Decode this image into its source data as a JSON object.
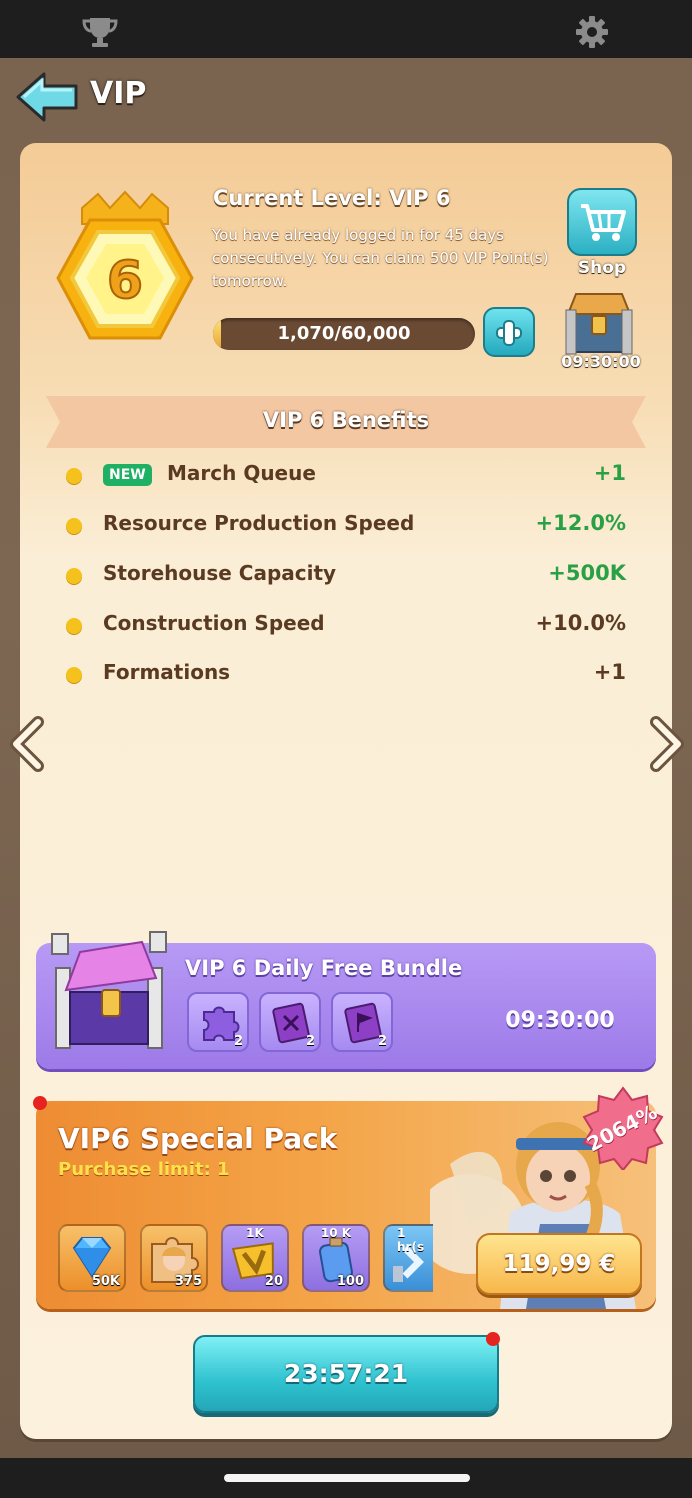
{
  "header": {
    "title": "VIP"
  },
  "vip": {
    "current_level": "Current Level: VIP 6",
    "level_number": "6",
    "login_message": "You have already logged in for 45 days consecutively. You can claim 500 VIP Point(s) tomorrow.",
    "progress_text": "1,070/60,000",
    "progress_fraction": 0.018,
    "shop_label": "Shop",
    "chest_timer": "09:30:00"
  },
  "benefits": {
    "title": "VIP 6 Benefits",
    "new_label": "NEW",
    "items": [
      {
        "name": "March Queue",
        "value": "+1",
        "is_new": true,
        "value_color": "green"
      },
      {
        "name": "Resource Production Speed",
        "value": "+12.0%",
        "is_new": false,
        "value_color": "green"
      },
      {
        "name": "Storehouse Capacity",
        "value": "+500K",
        "is_new": false,
        "value_color": "green"
      },
      {
        "name": "Construction Speed",
        "value": "+10.0%",
        "is_new": false,
        "value_color": "dark"
      },
      {
        "name": "Formations",
        "value": "+1",
        "is_new": false,
        "value_color": "dark"
      }
    ]
  },
  "daily_bundle": {
    "title": "VIP 6 Daily Free Bundle",
    "timer": "09:30:00",
    "items": [
      {
        "icon": "puzzle-piece-icon",
        "count": "2"
      },
      {
        "icon": "skill-book-icon",
        "count": "2"
      },
      {
        "icon": "flag-book-icon",
        "count": "2"
      }
    ]
  },
  "special_pack": {
    "title": "VIP6 Special Pack",
    "purchase_limit": "Purchase limit: 1",
    "discount": "2064%",
    "price": "119,99 €",
    "items": [
      {
        "icon": "diamond-icon",
        "top": "",
        "count": "50K"
      },
      {
        "icon": "hero-shard-icon",
        "top": "",
        "count": "375"
      },
      {
        "icon": "vip-point-icon",
        "top": "1K",
        "count": "20"
      },
      {
        "icon": "exp-potion-icon",
        "top": "10 K",
        "count": "100"
      },
      {
        "icon": "speedup-icon",
        "top": "1 hr(s",
        "count": ""
      }
    ]
  },
  "bottom_timer": "23:57:21",
  "colors": {
    "accent_teal": "#2fc2cf",
    "benefit_green": "#2aa046",
    "benefit_dark": "#5b3a22",
    "bundle_purple": "#9d7ae8",
    "pack_orange": "#ee8c33"
  }
}
